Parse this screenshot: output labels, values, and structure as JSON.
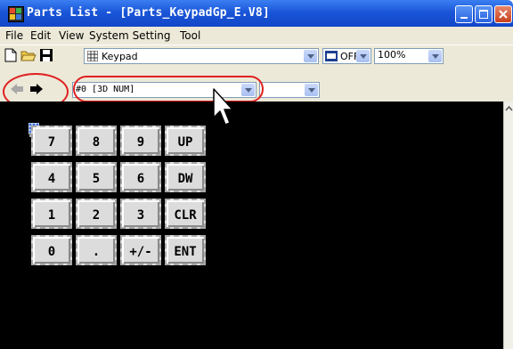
{
  "window": {
    "title": "Parts List - [Parts_KeypadGp_E.V8]"
  },
  "menu": [
    "File",
    "Edit",
    "View",
    "System Setting",
    "Tool"
  ],
  "toolbar": {
    "parts_category": "Keypad",
    "display_mode": "OFF",
    "zoom": "100%",
    "part_selector": "#0 [3D NUM]"
  },
  "keypad": {
    "keys": [
      [
        "7",
        "8",
        "9",
        "UP"
      ],
      [
        "4",
        "5",
        "6",
        "DW"
      ],
      [
        "1",
        "2",
        "3",
        "CLR"
      ],
      [
        "0",
        ".",
        "+/-",
        "ENT"
      ]
    ]
  },
  "colors": {
    "title_bar": "#1a56d8",
    "highlight": "#e02020",
    "canvas": "#000000"
  }
}
